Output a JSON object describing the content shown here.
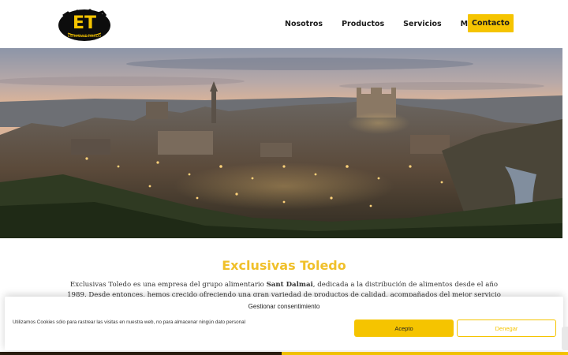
{
  "header": {
    "logo_alt": "Exclusivas Toledo",
    "nav": [
      "Nosotros",
      "Productos",
      "Servicios",
      "Marcas"
    ],
    "contact_label": "Contacto"
  },
  "main": {
    "title": "Exclusivas Toledo",
    "intro_part1": "Exclusivas Toledo es una empresa del grupo alimentario ",
    "intro_bold": "Sant Dalmai",
    "intro_part2": ", dedicada a la distribución de alimentos desde el año 1989. Desde entonces, hemos crecido ofreciendo una gran variedad de productos de calidad, acompañados del mejor servicio de distribución. Nos anticipamos a las"
  },
  "cookie_banner": {
    "title": "Gestionar consentimiento",
    "text": "Utilizamos Cookies sólo para rastrear las visitas en nuestra web, no para almacenar ningún dato personal",
    "accept_label": "Acepto",
    "deny_label": "Denegar"
  },
  "colors": {
    "accent": "#f5c400",
    "title": "#f0c02a"
  },
  "icons": {
    "logo": "et-logo"
  }
}
